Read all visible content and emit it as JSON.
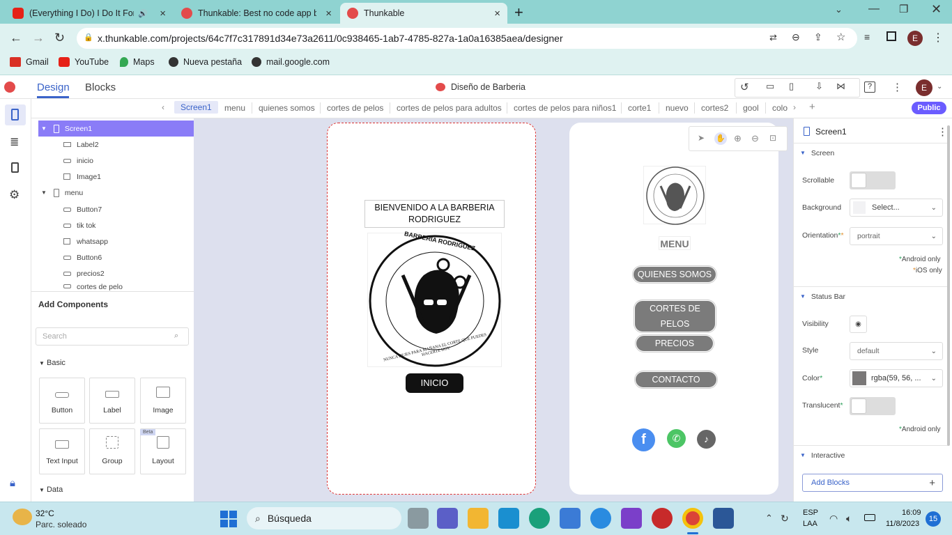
{
  "browser": {
    "tabs": [
      {
        "title": "(Everything I Do) I Do It For Y",
        "active": false
      },
      {
        "title": "Thunkable: Best no code app bui",
        "active": false
      },
      {
        "title": "Thunkable",
        "active": true
      }
    ],
    "new_tab_label": "+",
    "url": "x.thunkable.com/projects/64c7f7c317891d34e73a2611/0c938465-1ab7-4785-827a-1a0a16385aea/designer",
    "profile_initial": "E",
    "bookmarks": [
      "Gmail",
      "YouTube",
      "Maps",
      "Nueva pestaña",
      "mail.google.com"
    ]
  },
  "app": {
    "tab_design": "Design",
    "tab_blocks": "Blocks",
    "project_name": "Diseño de Barberia",
    "user_initial": "E",
    "public_label": "Public",
    "screens": [
      "Screen1",
      "menu",
      "quienes somos",
      "cortes de pelos",
      "cortes de pelos para adultos",
      "cortes de pelos para niños1",
      "corte1",
      "nuevo",
      "cortes2",
      "gool",
      "colo"
    ],
    "tree": [
      {
        "label": "Screen1",
        "level": 0,
        "selected": true
      },
      {
        "label": "Label2",
        "level": 1
      },
      {
        "label": "inicio",
        "level": 1
      },
      {
        "label": "Image1",
        "level": 1
      },
      {
        "label": "menu",
        "level": 0
      },
      {
        "label": "Button7",
        "level": 1
      },
      {
        "label": "tik tok",
        "level": 1
      },
      {
        "label": "whatsapp",
        "level": 1
      },
      {
        "label": "Button6",
        "level": 1
      },
      {
        "label": "precios2",
        "level": 1
      },
      {
        "label": "cortes de pelo",
        "level": 1
      }
    ],
    "add_components": {
      "title": "Add Components",
      "search_placeholder": "Search",
      "basic_label": "Basic",
      "data_label": "Data",
      "items": [
        {
          "label": "Button"
        },
        {
          "label": "Label"
        },
        {
          "label": "Image"
        },
        {
          "label": "Text Input"
        },
        {
          "label": "Group"
        },
        {
          "label": "Layout",
          "badge": "Beta"
        }
      ]
    },
    "phone1": {
      "welcome": "BIENVENIDO A LA BARBERIA RODRIGUEZ",
      "logo_top": "BARBERIA RODRIGUEZ",
      "logo_bottom": "NUNCA DEJES PARA MAÑANA EL CORTE QUE PUEDES HACERTE HOY",
      "button": "INICIO"
    },
    "phone2": {
      "title": "MENU",
      "buttons": [
        "QUIENES SOMOS",
        "CORTES DE PELOS",
        "PRECIOS",
        "CONTACTO"
      ],
      "social": [
        "facebook-icon",
        "whatsapp-icon",
        "tiktok-icon"
      ]
    },
    "properties": {
      "component": "Screen1",
      "section_screen": "Screen",
      "scrollable_label": "Scrollable",
      "background_label": "Background",
      "background_value": "Select...",
      "orientation_label": "Orientation",
      "orientation_value": "portrait",
      "android_only": "Android only",
      "ios_only": "iOS only",
      "section_status": "Status Bar",
      "visibility_label": "Visibility",
      "style_label": "Style",
      "style_value": "default",
      "color_label": "Color",
      "color_value": "rgba(59, 56, ...",
      "translucent_label": "Translucent",
      "android_only2": "Android only",
      "section_interactive": "Interactive",
      "add_blocks": "Add Blocks"
    }
  },
  "taskbar": {
    "temp": "32°C",
    "weather": "Parc. soleado",
    "search": "Búsqueda",
    "lang": "ESP",
    "lang2": "LAA",
    "time": "16:09",
    "date": "11/8/2023",
    "badge": "15"
  },
  "colors": {
    "accent": "#6b5cff",
    "chrome": "#8fd3d1",
    "tabbar_teal": "#dff2f1",
    "selected_row": "#8a7cf7"
  }
}
